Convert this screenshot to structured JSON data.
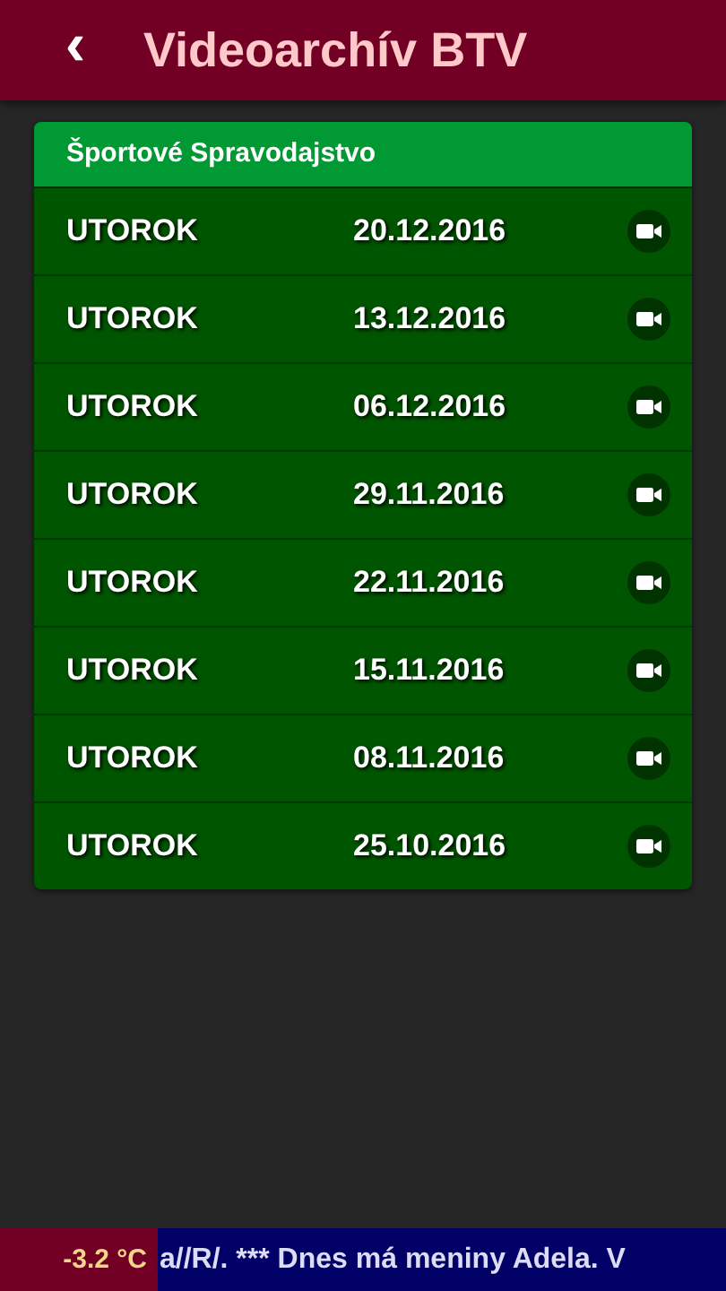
{
  "header": {
    "back": "‹",
    "title": "Videoarchív BTV"
  },
  "card": {
    "title": "Športové Spravodajstvo",
    "rows": [
      {
        "day": "UTOROK",
        "date": "20.12.2016"
      },
      {
        "day": "UTOROK",
        "date": "13.12.2016"
      },
      {
        "day": "UTOROK",
        "date": "06.12.2016"
      },
      {
        "day": "UTOROK",
        "date": "29.11.2016"
      },
      {
        "day": "UTOROK",
        "date": "22.11.2016"
      },
      {
        "day": "UTOROK",
        "date": "15.11.2016"
      },
      {
        "day": "UTOROK",
        "date": "08.11.2016"
      },
      {
        "day": "UTOROK",
        "date": "25.10.2016"
      }
    ]
  },
  "footer": {
    "temperature": "-3.2 °C",
    "ticker": "a//R/. *** Dnes má meniny Adela. V"
  }
}
